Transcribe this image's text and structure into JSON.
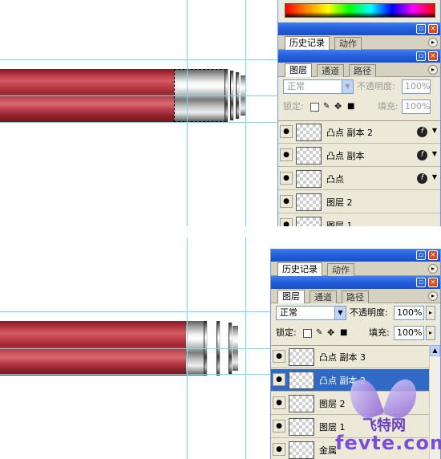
{
  "top_panel": {
    "history_tab": "历史记录",
    "actions_tab": "动作",
    "layers_tab": "图层",
    "channels_tab": "通道",
    "paths_tab": "路径",
    "blend_mode": "正常",
    "opacity_label": "不透明度:",
    "opacity_value": "100%",
    "lock_label": "锁定:",
    "fill_label": "填充:",
    "fill_value": "100%",
    "layers": [
      {
        "name": "凸点 副本 2",
        "has_effects": true
      },
      {
        "name": "凸点 副本",
        "has_effects": true
      },
      {
        "name": "凸点",
        "has_effects": true
      },
      {
        "name": "图层 2",
        "has_effects": false
      },
      {
        "name": "图层 1",
        "has_effects": false
      }
    ]
  },
  "bottom_panel": {
    "history_tab": "历史记录",
    "actions_tab": "动作",
    "layers_tab": "图层",
    "channels_tab": "通道",
    "paths_tab": "路径",
    "blend_mode": "正常",
    "opacity_label": "不透明度:",
    "opacity_value": "100%",
    "lock_label": "锁定:",
    "fill_label": "填充:",
    "fill_value": "100%",
    "layers": [
      {
        "name": "凸点 副本 3",
        "selected": false
      },
      {
        "name": "凸点 副本 2",
        "selected": true
      },
      {
        "name": "图层 2",
        "selected": false
      },
      {
        "name": "图层 1",
        "selected": false
      },
      {
        "name": "金属",
        "selected": false
      }
    ]
  },
  "watermark": {
    "line1": "飞特网",
    "line2": "fevte.com"
  },
  "icons": {
    "visibility": "eye-icon",
    "effects": "fx-icon",
    "minimize": "minimize-icon",
    "close": "close-icon"
  },
  "colors": {
    "pencil_red": "#b2333e",
    "guide_cyan": "#6fe0e8",
    "titlebar_blue": "#245edb",
    "selection_blue": "#316ac5",
    "panel_bg": "#ece9d8"
  }
}
